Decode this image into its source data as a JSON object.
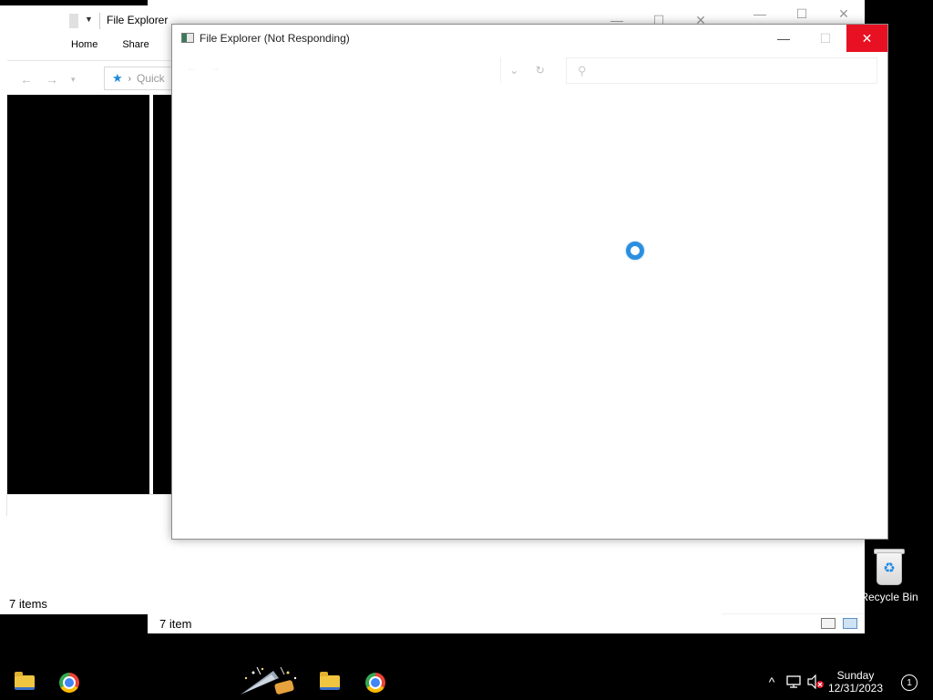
{
  "windows": {
    "back_right": {
      "status": "7 item",
      "controls": {
        "minimize": "—",
        "maximize": "☐",
        "close": "✕"
      }
    },
    "middle": {
      "title": "File Explorer",
      "tabs": [
        "Home",
        "Share"
      ],
      "address_text": "Quick",
      "status": "7 items",
      "controls": {
        "minimize": "—",
        "maximize": "☐",
        "close": "✕"
      }
    },
    "front": {
      "title": "File Explorer (Not Responding)",
      "controls": {
        "minimize": "—",
        "maximize": "☐",
        "close": "✕"
      },
      "refresh_glyph": "↻",
      "dropdown_glyph": "⌄",
      "search_glyph": "⚲"
    }
  },
  "desktop": {
    "recycle_bin_label": "Recycle Bin"
  },
  "taskbar": {
    "clock": {
      "day": "Sunday",
      "date": "12/31/2023"
    },
    "notification_count": "1",
    "tray_up_glyph": "^"
  },
  "colors": {
    "close_red": "#e81123",
    "spinner_blue": "#2b8fe0",
    "desktop_bg": "#000000"
  },
  "icons": [
    "folder-icon",
    "chrome-icon",
    "party-popper-icon",
    "recycle-bin-icon",
    "network-icon",
    "volume-muted-icon",
    "app-window-icon",
    "search-icon",
    "refresh-icon",
    "quick-access-star-icon"
  ]
}
